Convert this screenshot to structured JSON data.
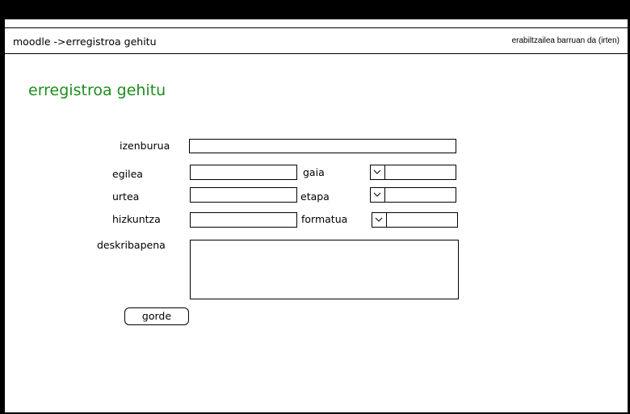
{
  "header": {
    "breadcrumb": "moodle ->erregistroa gehitu",
    "user_status": "erabiltzailea barruan da (irten)"
  },
  "page": {
    "title": "erregistroa gehitu"
  },
  "form": {
    "title_label": "izenburua",
    "title_value": "",
    "author_label": "egilea",
    "author_value": "",
    "subject_label": "gaia",
    "subject_value": "",
    "year_label": "urtea",
    "year_value": "",
    "stage_label": "etapa",
    "stage_value": "",
    "language_label": "hizkuntza",
    "language_value": "",
    "format_label": "formatua",
    "format_value": "",
    "description_label": "deskribapena",
    "description_value": "",
    "save_label": "gorde"
  },
  "colors": {
    "title_green": "#1e8c1e",
    "frame": "#000000"
  },
  "icons": {
    "dropdown": "chevron-down-icon"
  }
}
